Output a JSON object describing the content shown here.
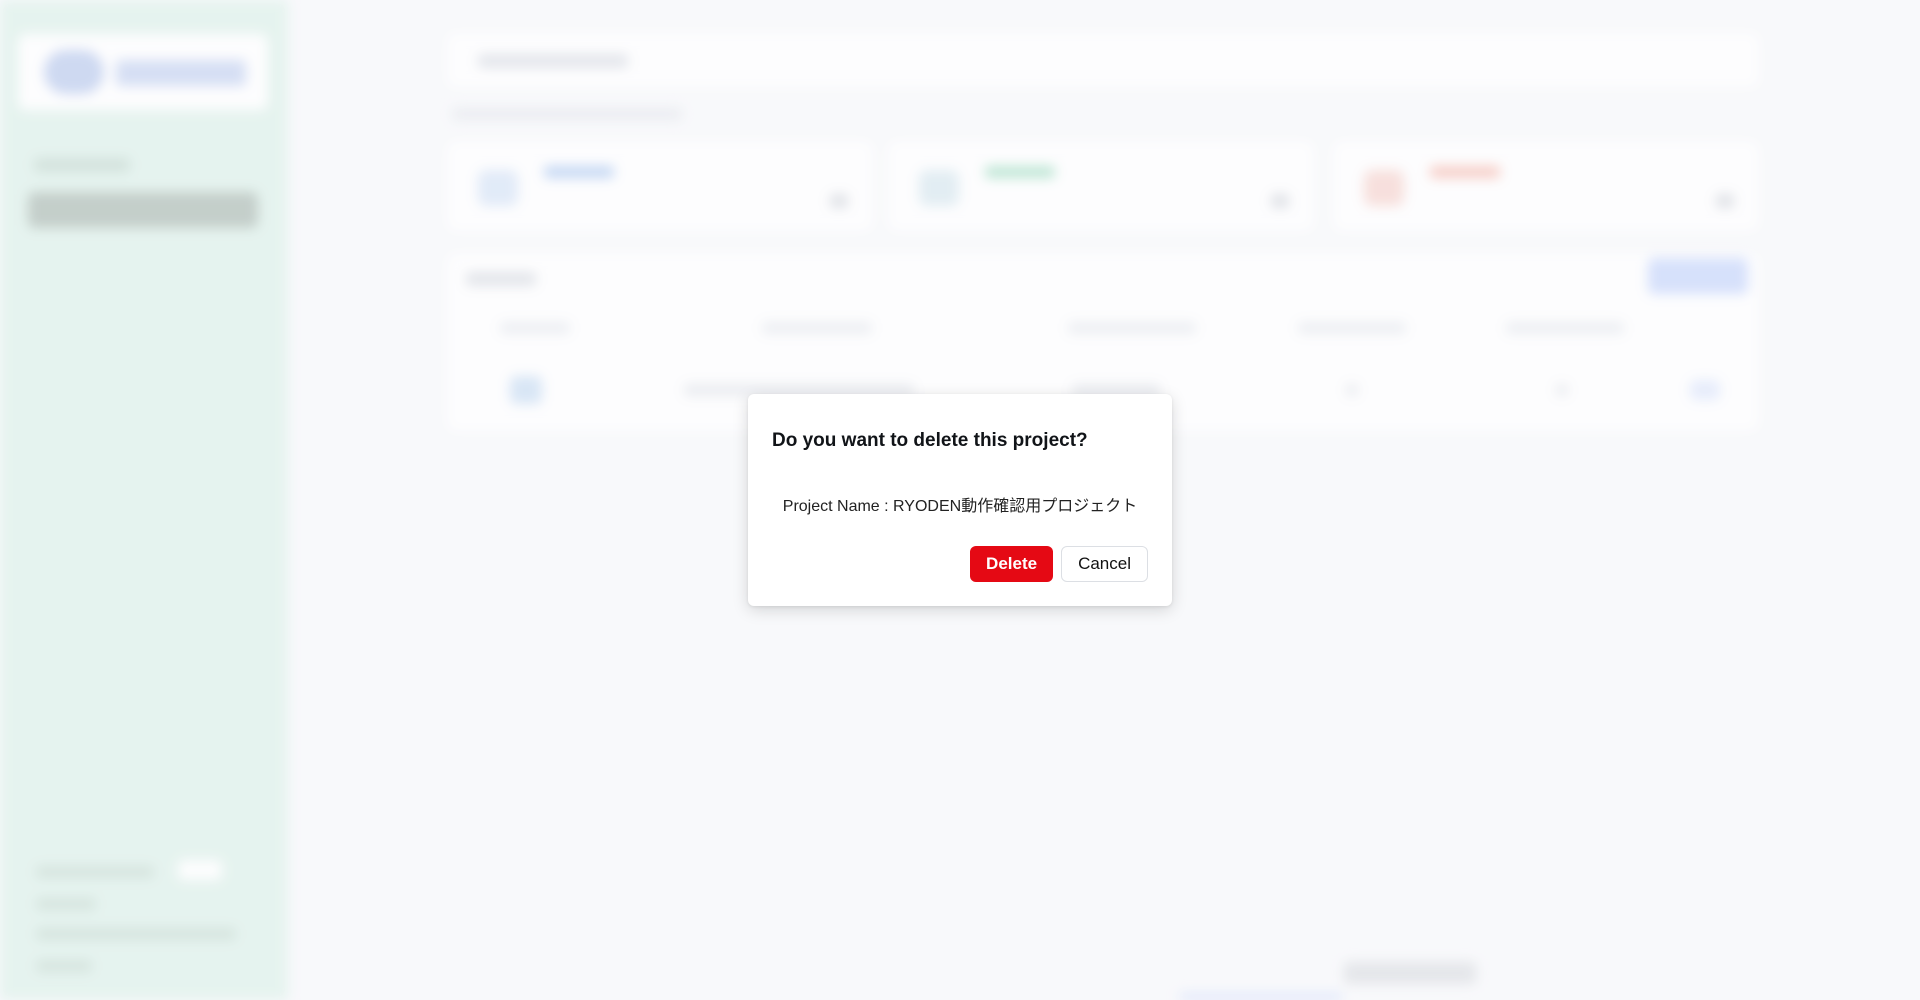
{
  "dialog": {
    "title": "Do you want to delete this project?",
    "message": "Project Name : RYODEN動作確認用プロジェクト",
    "delete_label": "Delete",
    "cancel_label": "Cancel"
  },
  "colors": {
    "danger": "#e50914",
    "sidebar_bg": "#dbf0e8",
    "overlay_tint": "#f8fafc"
  },
  "background": {
    "state": "blurred behind modal dialog",
    "stat_card_accents": [
      "#9dbbe6",
      "#8fd3b5",
      "#f2a39a"
    ]
  }
}
